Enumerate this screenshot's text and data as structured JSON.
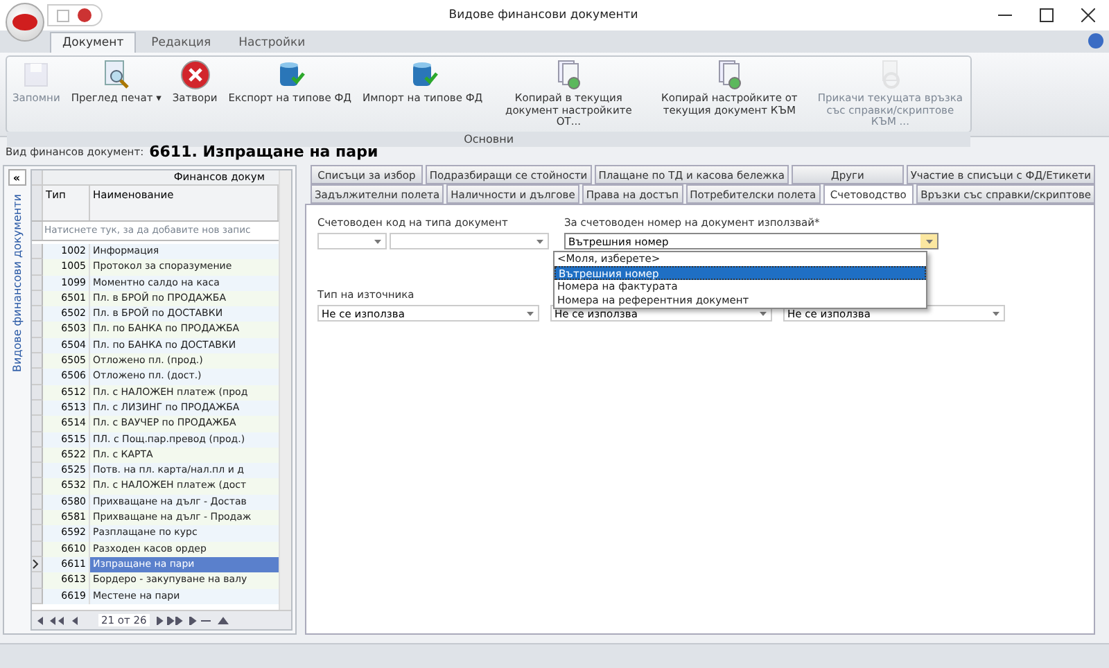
{
  "window": {
    "title": "Видове финансови документи"
  },
  "ribbon_tabs": [
    {
      "label": "Документ",
      "selected": true
    },
    {
      "label": "Редакция",
      "selected": false
    },
    {
      "label": "Настройки",
      "selected": false
    }
  ],
  "ribbon_group": {
    "label": "Основни",
    "buttons": [
      {
        "label": "Запомни",
        "kind": "save",
        "disabled": true
      },
      {
        "label": "Преглед печат ▾",
        "kind": "preview",
        "disabled": false
      },
      {
        "label": "Затвори",
        "kind": "close",
        "disabled": false
      },
      {
        "label": "Експорт на типове ФД",
        "kind": "export",
        "disabled": false
      },
      {
        "label": "Импорт на типове ФД",
        "kind": "import",
        "disabled": false
      },
      {
        "label": "Копирай в текущия документ настройките ОТ...",
        "kind": "copy",
        "disabled": false
      },
      {
        "label": "Копирай настройките от текущия документ КЪМ",
        "kind": "copy",
        "disabled": false
      },
      {
        "label": "Прикачи текущата връзка със справки/скриптове КЪМ ...",
        "kind": "attach",
        "disabled": true
      }
    ]
  },
  "header": {
    "label": "Вид финансов документ:",
    "value": "6611. Изпращане на пари"
  },
  "side_panel": {
    "caption": "Видове финансови документи",
    "collapse": "«"
  },
  "grid": {
    "band": "Финансов докум",
    "columns": [
      "Тип",
      "Наименование"
    ],
    "new_row": "Натиснете тук, за да добавите нов запис",
    "rows": [
      {
        "code": "1002",
        "name": "Информация",
        "selected": false
      },
      {
        "code": "1005",
        "name": "Протокол за споразумение",
        "selected": false
      },
      {
        "code": "1099",
        "name": "Моментно салдо на каса",
        "selected": false
      },
      {
        "code": "6501",
        "name": "Пл. в БРОЙ по ПРОДАЖБА",
        "selected": false
      },
      {
        "code": "6502",
        "name": "Пл. в БРОЙ по ДОСТАВКИ",
        "selected": false
      },
      {
        "code": "6503",
        "name": "Пл. по БАНКА по ПРОДАЖБА",
        "selected": false
      },
      {
        "code": "6504",
        "name": "Пл. по БАНКА по ДОСТАВКИ",
        "selected": false
      },
      {
        "code": "6505",
        "name": "Отложено пл. (прод.)",
        "selected": false
      },
      {
        "code": "6506",
        "name": "Отложено пл.  (дост.)",
        "selected": false
      },
      {
        "code": "6512",
        "name": "Пл. с НАЛОЖЕН платеж (прод",
        "selected": false
      },
      {
        "code": "6513",
        "name": "Пл. с ЛИЗИНГ по ПРОДАЖБА",
        "selected": false
      },
      {
        "code": "6514",
        "name": "Пл. с ВАУЧЕР по ПРОДАЖБА",
        "selected": false
      },
      {
        "code": "6515",
        "name": "ПЛ. с Пощ.пар.превод (прод.)",
        "selected": false
      },
      {
        "code": "6522",
        "name": "Пл. с КАРТА",
        "selected": false
      },
      {
        "code": "6525",
        "name": "Потв. на пл. карта/нал.пл и д",
        "selected": false
      },
      {
        "code": "6532",
        "name": "Пл. с НАЛОЖЕН платеж (дост",
        "selected": false
      },
      {
        "code": "6580",
        "name": "Прихващане на дълг - Достав",
        "selected": false
      },
      {
        "code": "6581",
        "name": "Прихващане на дълг - Продаж",
        "selected": false
      },
      {
        "code": "6592",
        "name": "Разплащане по курс",
        "selected": false
      },
      {
        "code": "6610",
        "name": "Разходен касов ордер",
        "selected": false
      },
      {
        "code": "6611",
        "name": "Изпращане на пари",
        "selected": true
      },
      {
        "code": "6613",
        "name": "Бордеро - закупуване на валу",
        "selected": false
      },
      {
        "code": "6619",
        "name": "Местене на пари",
        "selected": false
      }
    ],
    "pager": "21 от 26"
  },
  "tab_rows": [
    [
      {
        "label": "Списъци за избор",
        "selected": false
      },
      {
        "label": "Подразбиращи се стойности",
        "selected": false
      },
      {
        "label": "Плащане по ТД и касова бележка",
        "selected": false
      },
      {
        "label": "Други",
        "selected": false
      },
      {
        "label": "Участие в списъци с ФД/Етикети",
        "selected": false
      }
    ],
    [
      {
        "label": "Задължителни полета",
        "selected": false
      },
      {
        "label": "Наличности и дългове",
        "selected": false
      },
      {
        "label": "Права на достъп",
        "selected": false
      },
      {
        "label": "Потребителски полета",
        "selected": false
      },
      {
        "label": "Счетоводство",
        "selected": true
      },
      {
        "label": "Връзки със справки/скриптове",
        "selected": false
      }
    ]
  ],
  "form": {
    "code_label": "Счетоводен код на типа документ",
    "number_label": "За счетоводен номер на документ използвай*",
    "number_value": "Вътрешния номер",
    "options": [
      {
        "label": "<Моля, изберете>",
        "selected": false
      },
      {
        "label": "Вътрешния номер",
        "selected": true
      },
      {
        "label": "Номера на фактурата",
        "selected": false
      },
      {
        "label": "Номера на референтния документ",
        "selected": false
      }
    ],
    "source_label": "Тип на източника",
    "selects": [
      "Не се използва",
      "Не се използва",
      "Не се използва"
    ]
  }
}
